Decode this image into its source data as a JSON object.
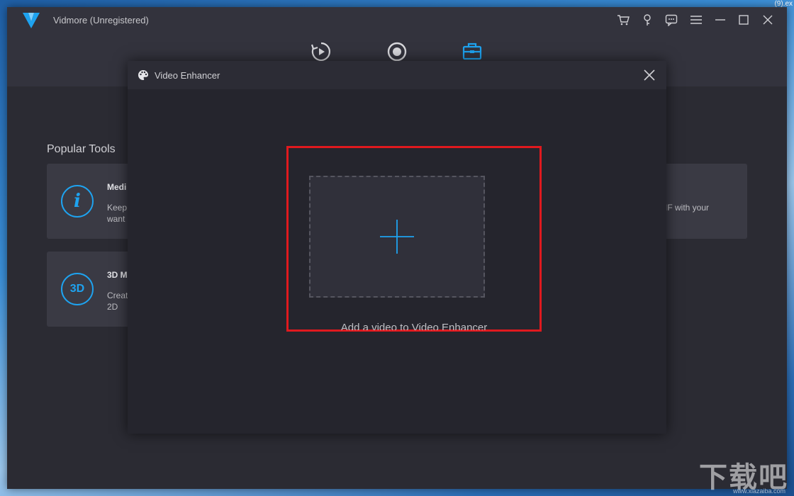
{
  "desktop": {
    "corner_label": "(9).ex",
    "watermark": "下载吧",
    "watermark_url": "www.xiazaiba.com"
  },
  "app": {
    "title": "Vidmore (Unregistered)",
    "accent_color": "#1ea3f0",
    "window_controls": [
      "cart-icon",
      "key-icon",
      "feedback-icon",
      "menu-icon",
      "minimize-icon",
      "maximize-icon",
      "close-icon"
    ],
    "nav_tabs": [
      {
        "icon": "converter-icon",
        "active": false
      },
      {
        "icon": "record-icon",
        "active": false
      },
      {
        "icon": "toolbox-icon",
        "active": true
      }
    ]
  },
  "content": {
    "popular_title": "Popular Tools",
    "cards": [
      {
        "icon": "info-icon",
        "icon_text": "i",
        "title": "Medi",
        "desc_line1": "Keep",
        "desc_line2": "want"
      },
      {
        "icon": "3d-icon",
        "icon_text": "3D",
        "title": "3D M",
        "desc_line1": "Creat",
        "desc_line2": "2D"
      },
      {
        "desc_line1": "IF with your"
      }
    ]
  },
  "modal": {
    "title": "Video Enhancer",
    "add_video_text": "Add a video to Video Enhancer",
    "highlight_color": "#e0191e"
  }
}
